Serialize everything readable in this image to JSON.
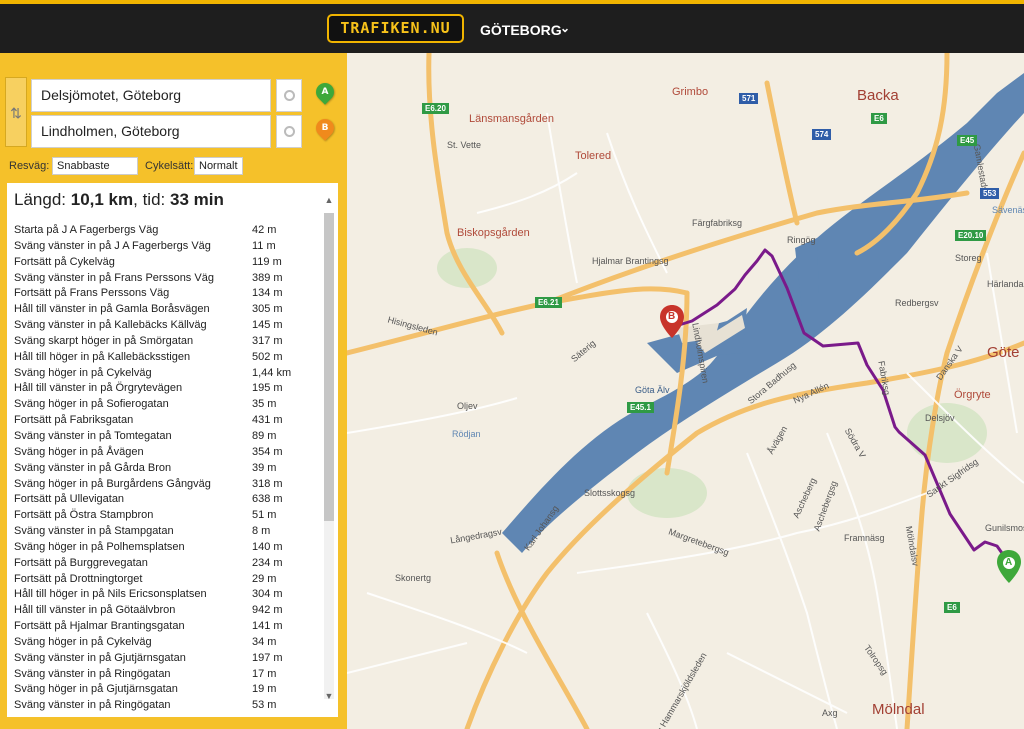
{
  "header": {
    "logo": "TRAFIKEN.NU",
    "city": "GÖTEBORG"
  },
  "route": {
    "from": "Delsjömotet, Göteborg",
    "to": "Lindholmen, Göteborg",
    "marker_a": "A",
    "marker_b": "B",
    "resvag_label": "Resväg:",
    "resvag_value": "Snabbaste",
    "cykelsatt_label": "Cykelsätt:",
    "cykelsatt_value": "Normalt"
  },
  "summary": {
    "length_label": "Längd:",
    "length_value": "10,1 km",
    "time_label": ", tid:",
    "time_value": "33 min"
  },
  "steps": [
    {
      "text": "Starta på J A Fagerbergs Väg",
      "dist": "42 m"
    },
    {
      "text": "Sväng vänster in på J A Fagerbergs Väg",
      "dist": "11 m"
    },
    {
      "text": "Fortsätt på Cykelväg",
      "dist": "119 m"
    },
    {
      "text": "Sväng vänster in på Frans Perssons Väg",
      "dist": "389 m"
    },
    {
      "text": "Fortsätt på Frans Perssons Väg",
      "dist": "134 m"
    },
    {
      "text": "Håll till vänster in på Gamla Boråsvägen",
      "dist": "305 m"
    },
    {
      "text": "Sväng vänster in på Kallebäcks Källväg",
      "dist": "145 m"
    },
    {
      "text": "Sväng skarpt höger in på Smörgatan",
      "dist": "317 m"
    },
    {
      "text": "Håll till höger in på Kallebäcksstigen",
      "dist": "502 m"
    },
    {
      "text": "Sväng höger in på Cykelväg",
      "dist": "1,44 km"
    },
    {
      "text": "Håll till vänster in på Örgrytevägen",
      "dist": "195 m"
    },
    {
      "text": "Sväng höger in på Sofierogatan",
      "dist": "35 m"
    },
    {
      "text": "Fortsätt på Fabriksgatan",
      "dist": "431 m"
    },
    {
      "text": "Sväng vänster in på Tomtegatan",
      "dist": "89 m"
    },
    {
      "text": "Sväng höger in på Åvägen",
      "dist": "354 m"
    },
    {
      "text": "Sväng vänster in på Gårda Bron",
      "dist": "39 m"
    },
    {
      "text": "Sväng höger in på Burgårdens Gångväg",
      "dist": "318 m"
    },
    {
      "text": "Fortsätt på Ullevigatan",
      "dist": "638 m"
    },
    {
      "text": "Fortsätt på Östra Stampbron",
      "dist": "51 m"
    },
    {
      "text": "Sväng vänster in på Stampgatan",
      "dist": "8 m"
    },
    {
      "text": "Sväng höger in på Polhemsplatsen",
      "dist": "140 m"
    },
    {
      "text": "Fortsätt på Burggrevegatan",
      "dist": "234 m"
    },
    {
      "text": "Fortsätt på Drottningtorget",
      "dist": "29 m"
    },
    {
      "text": "Håll till höger in på Nils Ericsonsplatsen",
      "dist": "304 m"
    },
    {
      "text": "Håll till vänster in på Götaälvbron",
      "dist": "942 m"
    },
    {
      "text": "Fortsätt på Hjalmar Brantingsgatan",
      "dist": "141 m"
    },
    {
      "text": "Sväng höger in på Cykelväg",
      "dist": "34 m"
    },
    {
      "text": "Sväng vänster in på Gjutjärnsgatan",
      "dist": "197 m"
    },
    {
      "text": "Sväng vänster in på Ringögatan",
      "dist": "17 m"
    },
    {
      "text": "Sväng höger in på Gjutjärnsgatan",
      "dist": "19 m"
    },
    {
      "text": "Sväng vänster in på Ringögatan",
      "dist": "53 m"
    }
  ],
  "map": {
    "colors": {
      "water": "#5f86b3",
      "land": "#f2ede2",
      "road": "#f7c46d",
      "route": "#7a1a8a",
      "pin_a": "#3ea83a",
      "pin_b": "#c8342b"
    },
    "districts": [
      "Backa",
      "Länsmansgården",
      "Tolered",
      "Biskopsgården",
      "Grimbo",
      "Örgryte",
      "Göte",
      "Mölndal",
      "Härlanda",
      "Sävenäs",
      "Gunilsmossen",
      "Rödjan",
      "Göta Älv",
      "St. Vette"
    ],
    "streets": [
      "Hjalmar Brantingsg",
      "Hisingsleden",
      "Ringög",
      "Färgfabriksg",
      "Lindholmspiren",
      "Säterig",
      "Nya Allén",
      "Stora Badhusg",
      "Oljev",
      "Slottsskogsg",
      "Karl Johansg",
      "Långedragsv",
      "Skonertg",
      "Framnäsg",
      "Mölndalsv",
      "Fabriksg",
      "Sankt Sigfridsg",
      "Delsjöv",
      "Danska V",
      "Redbergsv",
      "Ascheberg",
      "Margretebergsg",
      "Dag Hammarskjöldsleden",
      "Åvägen",
      "Gamlestadsv",
      "Storeg",
      "Axg",
      "Tolropsg",
      "Södra V",
      "Aschebergsg"
    ],
    "shields": [
      "E6.20",
      "571",
      "574",
      "E6",
      "E45",
      "553",
      "E20.10",
      "E6.21",
      "E45.1",
      "E6"
    ]
  }
}
